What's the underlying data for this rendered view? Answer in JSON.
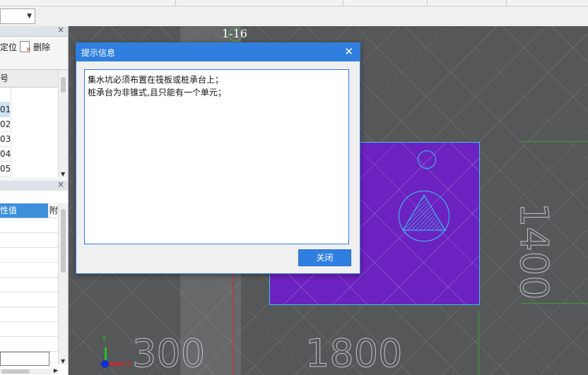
{
  "window": {
    "label_coordinate": "1-16"
  },
  "left_panel_top": {
    "toolbar": {
      "locate_label": "定位",
      "delete_label": "删除"
    },
    "table": {
      "header": "号",
      "rows": [
        "01",
        "02",
        "03",
        "04",
        "05"
      ]
    }
  },
  "left_panel_bottom": {
    "table": {
      "header_value": "性值",
      "header_extra": "附"
    }
  },
  "canvas": {
    "dimension_labels": [
      "300",
      "1800",
      "1400"
    ],
    "axis": {
      "x": "X",
      "y": "Y"
    },
    "colors": {
      "pit_fill": "#6c22c0",
      "pit_border": "#34c8f0",
      "background": "#555759"
    }
  },
  "dialog": {
    "title": "提示信息",
    "messages": [
      "集水坑必须布置在筏板或桩承台上；",
      "桩承台为非锥式,且只能有一个单元；"
    ],
    "close_button": "关闭"
  }
}
